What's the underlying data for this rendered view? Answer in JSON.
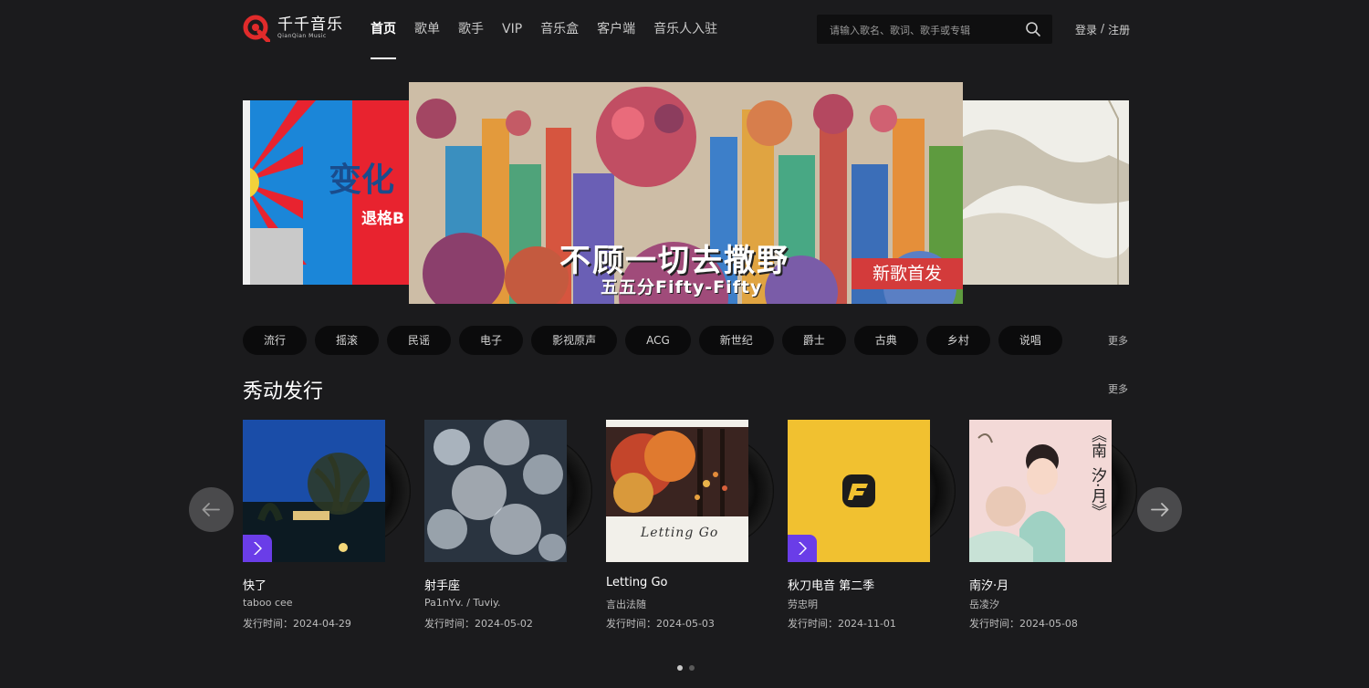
{
  "logo": {
    "name_cn": "千千音乐",
    "name_en": "QianQian Music"
  },
  "nav": [
    "首页",
    "歌单",
    "歌手",
    "VIP",
    "音乐盒",
    "客户端",
    "音乐人入驻"
  ],
  "search": {
    "placeholder": "请输入歌名、歌词、歌手或专辑"
  },
  "auth": {
    "login": "登录",
    "sep": "/",
    "register": "注册"
  },
  "banner": {
    "left_text1": "变化",
    "left_text2": "退格B",
    "main_title": "不顾一切去撒野",
    "main_sub": "五五分Fifty-Fifty",
    "main_tag": "新歌首发"
  },
  "genres": [
    "流行",
    "摇滚",
    "民谣",
    "电子",
    "影视原声",
    "ACG",
    "新世纪",
    "爵士",
    "古典",
    "乡村",
    "说唱"
  ],
  "genres_more": "更多",
  "section": {
    "title": "秀动发行",
    "more": "更多"
  },
  "albums": [
    {
      "name": "快了",
      "artist": "taboo cee",
      "date": "发行时间：2024-04-29"
    },
    {
      "name": "射手座",
      "artist": "Pa1nYv. / Tuviy.",
      "date": "发行时间：2024-05-02"
    },
    {
      "name": "Letting Go",
      "artist": "言出法随",
      "date": "发行时间：2024-05-03",
      "cover_text": "Letting Go"
    },
    {
      "name": "秋刀电音 第二季",
      "artist": "劳忠明",
      "date": "发行时间：2024-11-01"
    },
    {
      "name": "南汐·月",
      "artist": "岳凌汐",
      "date": "发行时间：2024-05-08",
      "cover_text1": "《南",
      "cover_text2": "汐·月》"
    }
  ],
  "pagination": {
    "total": 2,
    "active": 1
  }
}
